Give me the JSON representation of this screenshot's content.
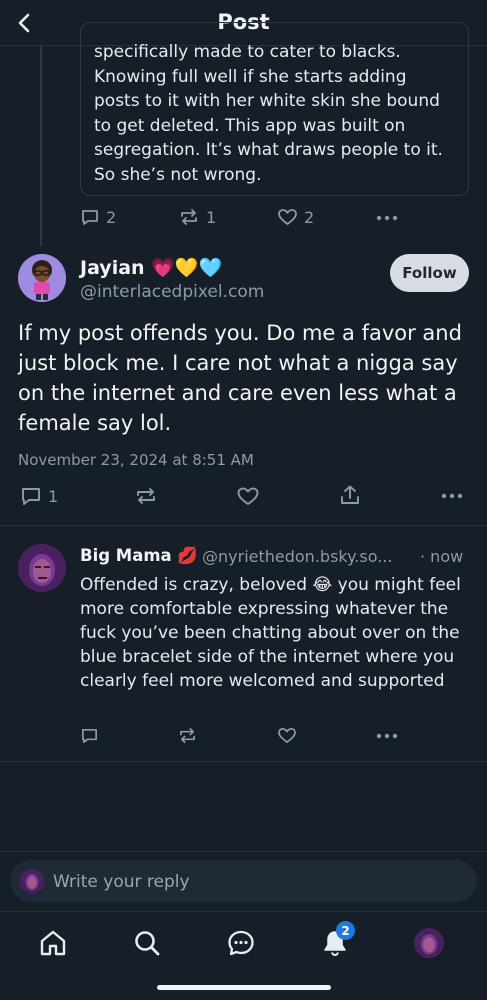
{
  "header": {
    "title": "Post"
  },
  "quoted_post": {
    "text": "specifically made to cater to blacks. Knowing full well if she starts adding posts to it with her white skin she bound to get deleted. This app was built on segregation. It’s what draws people to it. So she’s not wrong.",
    "replies": "2",
    "reposts": "1",
    "likes": "2"
  },
  "main_post": {
    "display_name": "Jayian 💗💛🩵",
    "handle": "@interlacedpixel.com",
    "follow_label": "Follow",
    "text": "If my post offends you. Do me a favor and just block me. I care not what a nigga say on the internet and care even less what a female say lol.",
    "timestamp": "November 23, 2024 at 8:51 AM",
    "replies": "1"
  },
  "reply": {
    "display_name": "Big Mama 💋",
    "handle": "@nyriethedon.bsky.so...",
    "time": "· now",
    "text": "Offended is crazy, beloved 😂 you might feel more comfortable expressing whatever the fuck you’ve been chatting about over on the blue bracelet side of the internet where you clearly feel more welcomed and supported"
  },
  "compose": {
    "placeholder": "Write your reply"
  },
  "tabbar": {
    "notifications_badge": "2"
  },
  "colors": {
    "background": "#161e27",
    "accent": "#1f7ae0",
    "muted": "#8d9aa8"
  },
  "icons": [
    "chevron-left-icon",
    "reply-icon",
    "repost-icon",
    "heart-icon",
    "more-icon",
    "share-icon",
    "home-icon",
    "search-icon",
    "chat-icon",
    "bell-icon"
  ]
}
